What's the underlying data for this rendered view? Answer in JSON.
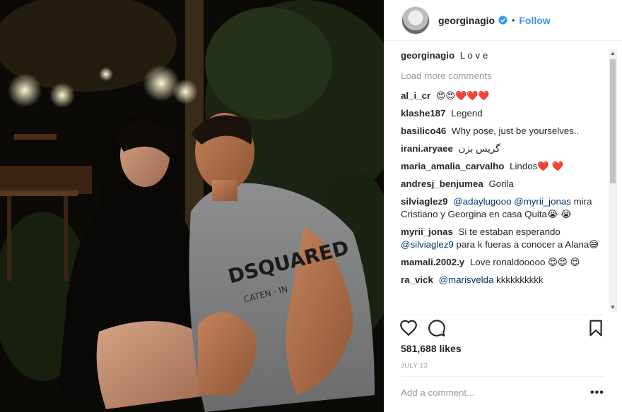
{
  "header": {
    "username": "georginagio",
    "separator": "•",
    "follow_label": "Follow"
  },
  "caption": {
    "user": "georginagio",
    "text": "L o v e"
  },
  "load_more": "Load more comments",
  "comments": [
    {
      "user": "al_i_cr",
      "text": "😍😍❤️❤️❤️"
    },
    {
      "user": "klashe187",
      "text": "Legend"
    },
    {
      "user": "basilico46",
      "text": "Why pose, just be yourselves.."
    },
    {
      "user": "irani.aryaee",
      "text": "گریس بزن"
    },
    {
      "user": "maria_amalia_carvalho",
      "text": "Lindos❤️ ❤️"
    },
    {
      "user": "andresj_benjumea",
      "text": "Gorila"
    },
    {
      "user": "silviaglez9",
      "mention1": "@adaylugooo",
      "mention2": "@myrii_jonas",
      "text": "mira Cristiano y Georgina en casa Quita😭 😭"
    },
    {
      "user": "myrii_jonas",
      "text1": "Si te estaban esperando",
      "mention1": "@silviaglez9",
      "text2": "para k fueras a conocer a Alana😅"
    },
    {
      "user": "mamali.2002.y",
      "text": "Love ronaldooooo 😍😍 😍"
    },
    {
      "user": "ra_vick",
      "mention1": "@marisvelda",
      "text": "kkkkkkkkkk"
    }
  ],
  "likes": "581,688 likes",
  "date": "JULY 13",
  "add_comment_placeholder": "Add a comment...",
  "more_label": "•••",
  "icons": {
    "like": "heart-icon",
    "comment": "comment-icon",
    "save": "bookmark-icon",
    "verified": "verified-badge-icon"
  },
  "colors": {
    "accent": "#3897f0",
    "mention": "#003569",
    "muted": "#999999",
    "text": "#262626"
  }
}
